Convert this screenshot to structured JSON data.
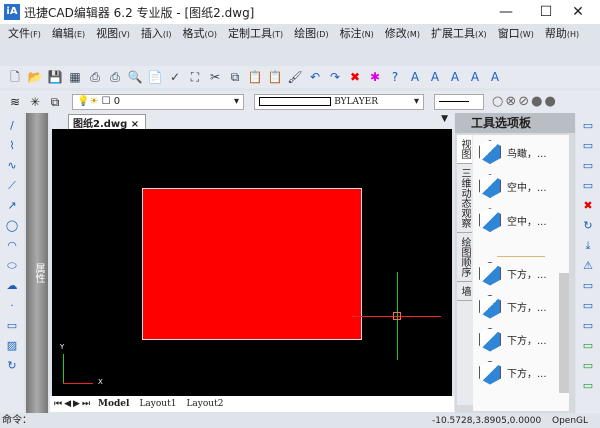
{
  "window": {
    "title": "迅捷CAD编辑器 6.2 专业版  - [图纸2.dwg]",
    "logo": "iA",
    "minimize": "—",
    "maximize": "☐",
    "close": "✕"
  },
  "menu": [
    {
      "label": "文件",
      "key": "(F)"
    },
    {
      "label": "编辑",
      "key": "(E)"
    },
    {
      "label": "视图",
      "key": "(V)"
    },
    {
      "label": "插入",
      "key": "(I)"
    },
    {
      "label": "格式",
      "key": "(O)"
    },
    {
      "label": "定制工具",
      "key": "(T)"
    },
    {
      "label": "绘图",
      "key": "(D)"
    },
    {
      "label": "标注",
      "key": "(N)"
    },
    {
      "label": "修改",
      "key": "(M)"
    },
    {
      "label": "扩展工具",
      "key": "(X)"
    },
    {
      "label": "窗口",
      "key": "(W)"
    },
    {
      "label": "帮助",
      "key": "(H)"
    }
  ],
  "toolbar": {
    "layer_value": "0",
    "linetype_value": "BYLAYER",
    "icons": [
      "new",
      "open",
      "save",
      "table",
      "print-preview",
      "print",
      "preview",
      "publish",
      "spellcheck",
      "find",
      "cut",
      "copy",
      "paste",
      "paste-special",
      "match-properties",
      "undo",
      "redo",
      "delete",
      "purge",
      "help",
      "text",
      "text-small",
      "text-edit",
      "text-style",
      "text-find"
    ]
  },
  "doc_tab": {
    "label": "图纸2.dwg",
    "close": "×"
  },
  "properties_strip": "属性",
  "layout_tabs": [
    "Model",
    "Layout1",
    "Layout2"
  ],
  "ucs": {
    "x": "X",
    "y": "Y"
  },
  "palette": {
    "title": "工具选项板",
    "tabs": [
      "视图",
      "三维动态观察",
      "绘图顺序",
      "墙"
    ],
    "items": [
      "鸟瞰，...",
      "空中，...",
      "空中，...",
      "下方，...",
      "下方，...",
      "下方，...",
      "下方，..."
    ]
  },
  "status": {
    "command": "命令：",
    "coords": "-10.5728,3.8905,0.0000",
    "render": "OpenGL"
  },
  "colors": {
    "rect": "#ff0000",
    "canvas": "#000000",
    "crosshair_h": "#ff2020",
    "crosshair_v": "#20c020"
  }
}
